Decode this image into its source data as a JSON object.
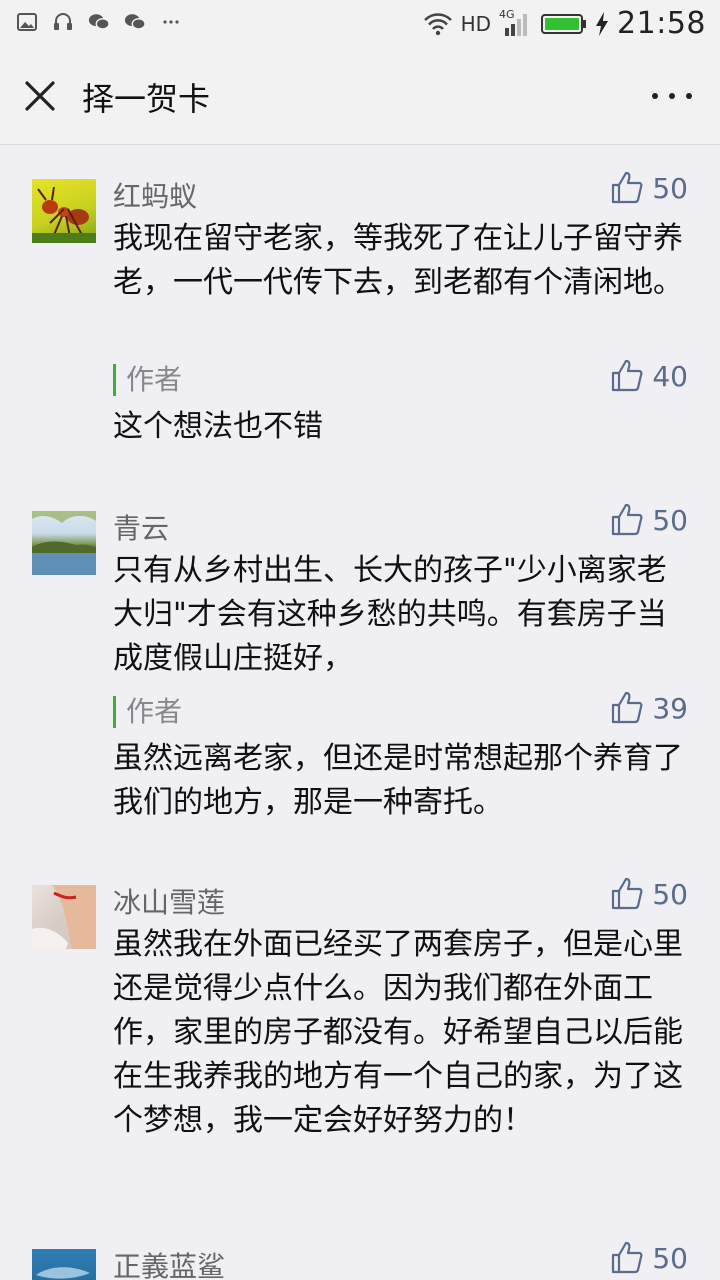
{
  "status_bar": {
    "network": "HD",
    "signal_tag": "4G",
    "time": "21:58"
  },
  "header": {
    "title": "择一贺卡"
  },
  "comments": [
    {
      "nickname": "红蚂蚁",
      "likes": "50",
      "text": "我现在留守老家，等我死了在让儿子留守养老，一代一代传下去，到老都有个清闲地。",
      "reply": {
        "label": "作者",
        "likes": "40",
        "text": "这个想法也不错"
      }
    },
    {
      "nickname": "青云",
      "likes": "50",
      "text": "只有从乡村出生、长大的孩子\"少小离家老大归\"才会有这种乡愁的共鸣。有套房子当成度假山庄挺好，",
      "reply": {
        "label": "作者",
        "likes": "39",
        "text": "虽然远离老家，但还是时常想起那个养育了我们的地方，那是一种寄托。"
      }
    },
    {
      "nickname": "冰山雪莲",
      "likes": "50",
      "text": "虽然我在外面已经买了两套房子，但是心里还是觉得少点什么。因为我们都在外面工作，家里的房子都没有。好希望自己以后能在生我养我的地方有一个自己的家，为了这个梦想，我一定会好好努力的！"
    },
    {
      "nickname": "正義蓝鲨",
      "likes": "50"
    }
  ],
  "colors": {
    "like_blue": "#5a6b8c",
    "author_bar": "#3cb034",
    "background": "#efeff4"
  },
  "icons": {
    "close": "close-icon",
    "more": "more-icon",
    "like": "thumbs-up-icon"
  }
}
